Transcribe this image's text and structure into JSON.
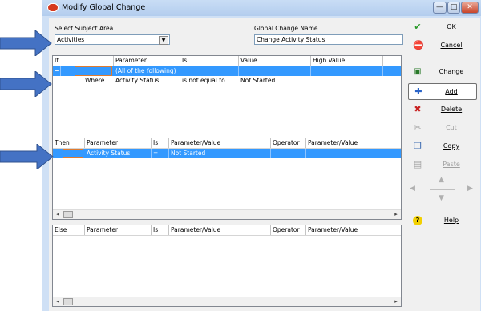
{
  "window": {
    "title": "Modify Global Change"
  },
  "subject_area": {
    "label": "Select Subject Area",
    "value": "Activities"
  },
  "change_name": {
    "label": "Global Change Name",
    "value": "Change Activity Status"
  },
  "if_grid": {
    "columns": [
      "If",
      "Parameter",
      "Is",
      "Value",
      "High Value"
    ],
    "rows": [
      {
        "if": "",
        "parameter": "(All of the following)",
        "is": "",
        "value": "",
        "high": "",
        "toggle": "−"
      },
      {
        "if": "Where",
        "parameter": "Activity Status",
        "is": "is not equal to",
        "value": "Not Started",
        "high": ""
      }
    ]
  },
  "then_grid": {
    "columns": [
      "Then",
      "Parameter",
      "Is",
      "Parameter/Value",
      "Operator",
      "Parameter/Value"
    ],
    "rows": [
      {
        "then": "",
        "parameter": "Activity Status",
        "is": "=",
        "value": "Not Started",
        "operator": "",
        "value2": ""
      }
    ]
  },
  "else_grid": {
    "columns": [
      "Else",
      "Parameter",
      "Is",
      "Parameter/Value",
      "Operator",
      "Parameter/Value"
    ]
  },
  "buttons": {
    "ok": "OK",
    "cancel": "Cancel",
    "change": "Change",
    "add": "Add",
    "delete": "Delete",
    "cut": "Cut",
    "copy": "Copy",
    "paste": "Paste",
    "help": "Help"
  },
  "colors": {
    "selection": "#3399ff",
    "window_frame": "#cfe0f5",
    "arrow": "#4472c4"
  },
  "icons": [
    "app-icon",
    "minimize-icon",
    "maximize-icon",
    "close-icon",
    "checkmark-icon",
    "no-entry-icon",
    "change-icon",
    "plus-icon",
    "x-icon",
    "scissors-icon",
    "copy-icon",
    "paste-icon",
    "help-icon"
  ]
}
